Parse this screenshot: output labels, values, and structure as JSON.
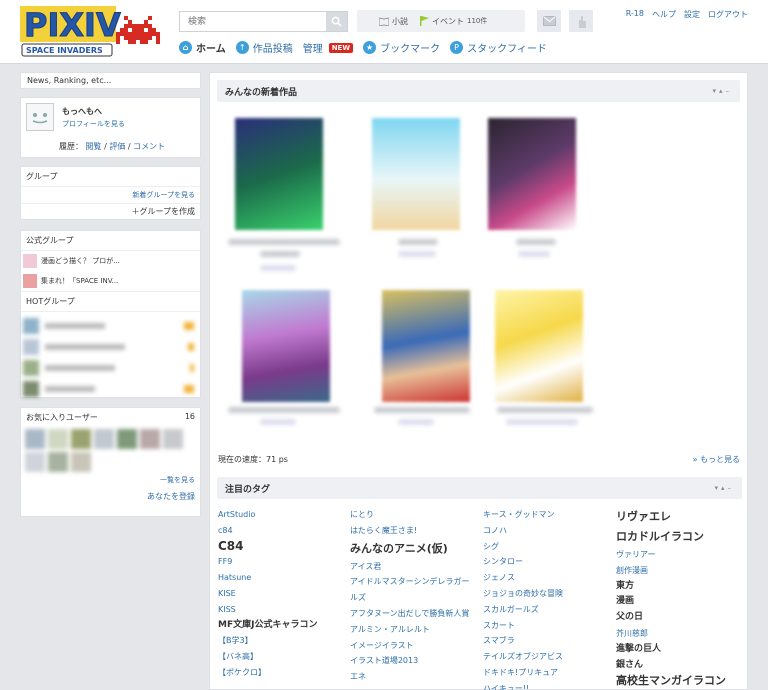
{
  "logo": {
    "wordmark": "PIXIV",
    "subtitle": "SPACE INVADERS"
  },
  "search": {
    "placeholder": "検索"
  },
  "pills": {
    "novel": "小説",
    "event": "イベント",
    "event_count": "110件"
  },
  "top_links": [
    "R-18",
    "ヘルプ",
    "設定",
    "ログアウト"
  ],
  "nav": {
    "home": "ホーム",
    "post": "作品投稿",
    "manage": "管理",
    "new_badge": "NEW",
    "bookmark": "ブックマーク",
    "staccfeed": "スタックフィード"
  },
  "left": {
    "news_label": "News, Ranking, etc...",
    "profile": {
      "name": "もっへもへ",
      "profile_link": "プロフィールを見る",
      "history_label": "履歴：",
      "history_links": [
        "閲覧",
        "評価",
        "コメント"
      ]
    },
    "group": {
      "title": "グループ",
      "new_groups_link": "新着グループを見る",
      "create_link": "＋グループを作成"
    },
    "official_group": {
      "title": "公式グループ",
      "items": [
        "漫画どう描く？ プロが...",
        "集まれ！「SPACE INV..."
      ]
    },
    "hot_group": {
      "title": "HOTグループ"
    },
    "favorites": {
      "title": "お気に入りユーザー",
      "count": "16",
      "list_link": "一覧を見る",
      "registered_link": "あなたを登録"
    }
  },
  "main": {
    "new_works_title": "みんなの新着作品",
    "speed_text": "現在の速度：71 ps",
    "more_link": "もっと見る",
    "tags_title": "注目のタグ",
    "tags_col1": [
      "ArtStudio",
      "c84",
      "C84",
      "FF9",
      "Hatsune",
      "KISE",
      "KISS",
      "MF文庫J公式キャラコン",
      "【B学3】",
      "【バネ高】",
      "【ポケクロ】"
    ],
    "tags_col2": [
      "にとり",
      "はたらく魔王さま!",
      "みんなのアニメ(仮)",
      "アイス君",
      "アイドルマスターシンデレラガールズ",
      "アフタヌーン出だしで勝負新人賞",
      "アルミン・アルレルト",
      "イメージイラスト",
      "イラスト道場2013",
      "エネ"
    ],
    "tags_col3": [
      "キース・グッドマン",
      "コノハ",
      "シグ",
      "シンタロー",
      "ジェノス",
      "ジョジョの奇妙な冒険",
      "スカルガールズ",
      "スカート",
      "スマブラ",
      "テイルズオブジアビス",
      "ドキドキ!プリキュア",
      "ハイキュー!!"
    ],
    "tags_col4": [
      "リヴァエレ",
      "ロカドルイラコン",
      "ヴァリアー",
      "創作漫画",
      "東方",
      "漫画",
      "父の日",
      "芥川慈郎",
      "進撃の巨人",
      "銀さん",
      "高校生マンガイラコン"
    ]
  }
}
